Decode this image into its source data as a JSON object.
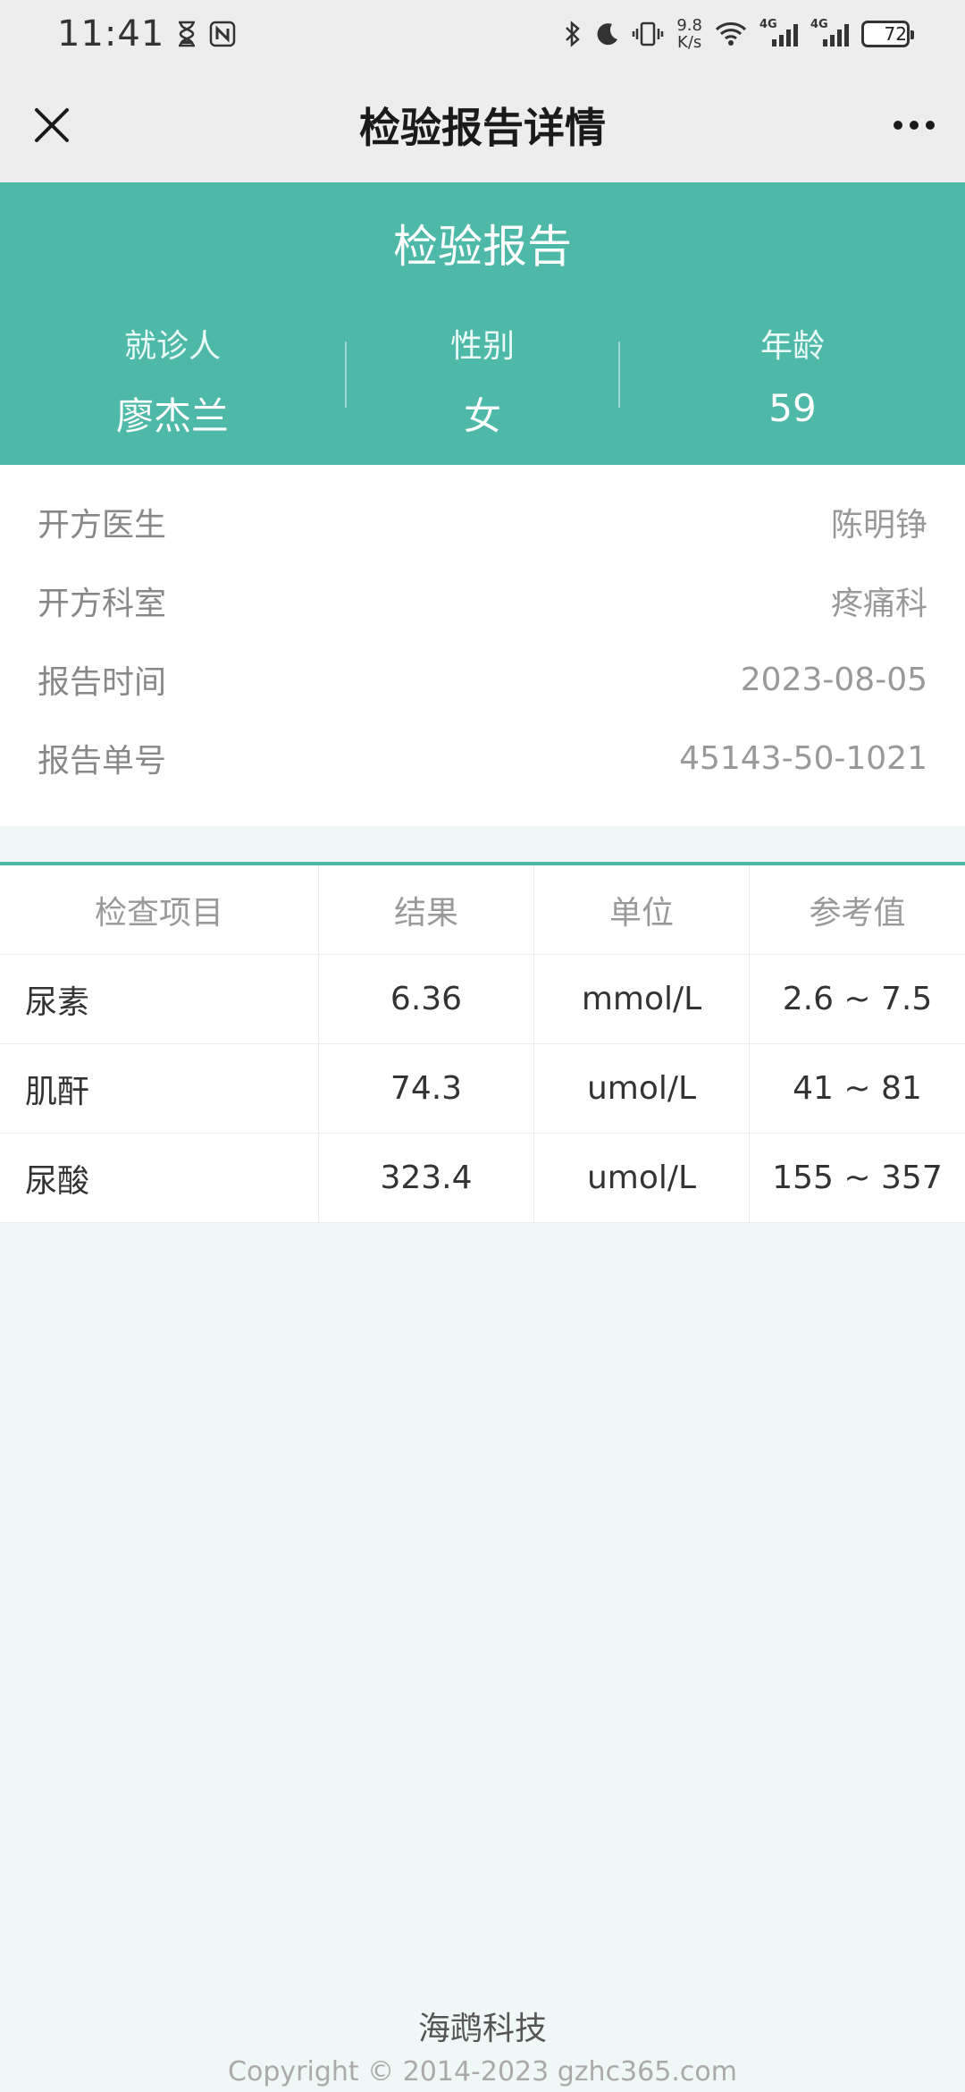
{
  "status_bar": {
    "time": "11:41",
    "net_speed_value": "9.8",
    "net_speed_unit": "K/s",
    "signal1_tag": "4G",
    "signal2_tag": "4G",
    "battery": "72",
    "icons": [
      "hourglass-icon",
      "nfc-icon",
      "bluetooth-icon",
      "moon-icon",
      "vibrate-icon",
      "wifi-icon",
      "signal-icon",
      "battery-icon"
    ]
  },
  "nav": {
    "title": "检验报告详情",
    "close_icon": "close-icon",
    "more_icon": "more-icon"
  },
  "header": {
    "title": "检验报告",
    "patient": [
      {
        "label": "就诊人",
        "value": "廖杰兰"
      },
      {
        "label": "性别",
        "value": "女"
      },
      {
        "label": "年龄",
        "value": "59"
      }
    ]
  },
  "info": [
    {
      "label": "开方医生",
      "value": "陈明铮"
    },
    {
      "label": "开方科室",
      "value": "疼痛科"
    },
    {
      "label": "报告时间",
      "value": "2023-08-05"
    },
    {
      "label": "报告单号",
      "value": "45143-50-1021"
    }
  ],
  "table": {
    "headers": [
      "检查项目",
      "结果",
      "单位",
      "参考值"
    ],
    "rows": [
      [
        "尿素",
        "6.36",
        "mmol/L",
        "2.6 ~ 7.5"
      ],
      [
        "肌酐",
        "74.3",
        "umol/L",
        "41 ~ 81"
      ],
      [
        "尿酸",
        "323.4",
        "umol/L",
        "155 ~ 357"
      ]
    ]
  },
  "footer": {
    "brand": "海鹉科技",
    "copyright": "Copyright © 2014-2023 gzhc365.com"
  },
  "colors": {
    "accent": "#4eb8a9",
    "page_bg": "#f0f8f7",
    "bar_bg": "#ededed"
  }
}
